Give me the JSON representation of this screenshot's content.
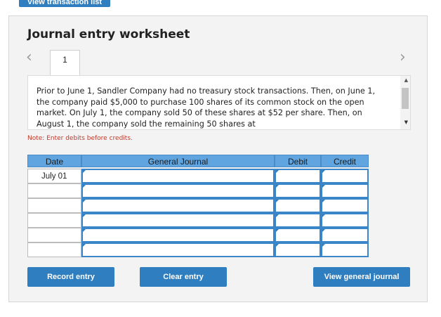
{
  "top_button": {
    "label": "View transaction list"
  },
  "worksheet": {
    "title": "Journal entry worksheet",
    "tabs": [
      {
        "label": "1"
      }
    ],
    "prompt": "Prior to June 1, Sandler Company had no treasury stock transactions. Then, on June 1, the company paid $5,000 to purchase 100 shares of its common stock on the open market. On July 1, the company sold 50 of these shares at $52 per share. Then, on August 1, the company sold the remaining 50 shares at",
    "note": "Note: Enter debits before credits."
  },
  "table": {
    "headers": {
      "date": "Date",
      "general_journal": "General Journal",
      "debit": "Debit",
      "credit": "Credit"
    },
    "rows": [
      {
        "date": "July 01",
        "account": "",
        "debit": "",
        "credit": ""
      },
      {
        "date": "",
        "account": "",
        "debit": "",
        "credit": ""
      },
      {
        "date": "",
        "account": "",
        "debit": "",
        "credit": ""
      },
      {
        "date": "",
        "account": "",
        "debit": "",
        "credit": ""
      },
      {
        "date": "",
        "account": "",
        "debit": "",
        "credit": ""
      },
      {
        "date": "",
        "account": "",
        "debit": "",
        "credit": ""
      }
    ]
  },
  "buttons": {
    "record": "Record entry",
    "clear": "Clear entry",
    "view_journal": "View general journal"
  },
  "icons": {
    "prev": "chevron-left-icon",
    "next": "chevron-right-icon"
  },
  "colors": {
    "accent": "#2f7ebf",
    "header": "#61a5e0",
    "note": "#c0392b"
  }
}
